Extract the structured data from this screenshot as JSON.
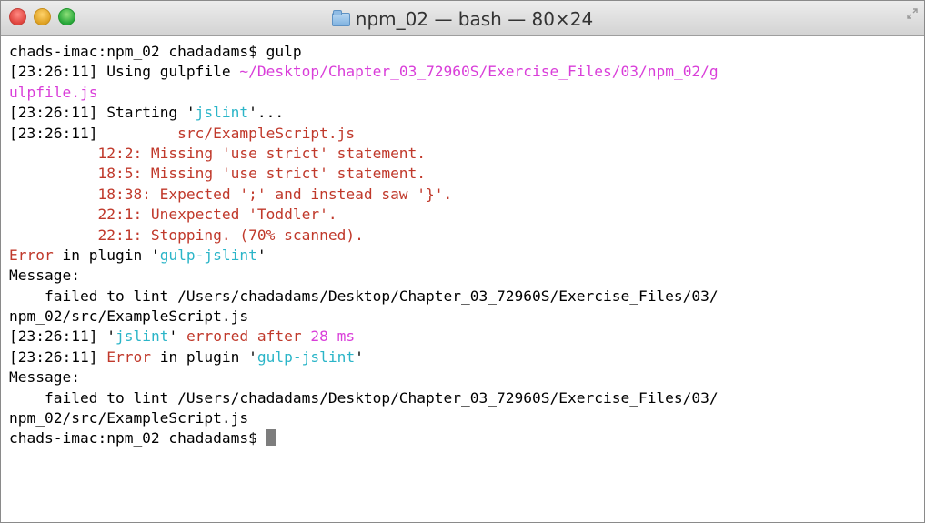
{
  "window": {
    "title": "npm_02 — bash — 80×24"
  },
  "terminal": {
    "colors": {
      "red": "#c0392b",
      "cyan": "#2bb5c8",
      "magenta": "#d93ed9",
      "default": "#000000"
    },
    "lines": [
      {
        "prompt": "chads-imac:npm_02 chadadams$ ",
        "cmd": "gulp"
      },
      {
        "ts": "[23:26:11]",
        "text": " Using gulpfile ",
        "path": "~/Desktop/Chapter_03_72960S/Exercise_Files/03/npm_02/g"
      },
      {
        "path_cont": "ulpfile.js"
      },
      {
        "ts": "[23:26:11]",
        "text": " Starting '",
        "task": "jslint",
        "text2": "'..."
      },
      {
        "ts": "[23:26:11]",
        "file": "         src/ExampleScript.js"
      },
      {
        "err": "          12:2: Missing 'use strict' statement."
      },
      {
        "err": "          18:5: Missing 'use strict' statement."
      },
      {
        "err": "          18:38: Expected ';' and instead saw '}'."
      },
      {
        "err": "          22:1: Unexpected 'Toddler'."
      },
      {
        "err": "          22:1: Stopping. (70% scanned)."
      },
      {
        "error_word": "Error",
        "text": " in plugin '",
        "plugin": "gulp-jslint",
        "text2": "'"
      },
      {
        "plain": "Message:"
      },
      {
        "plain": "    failed to lint /Users/chadadams/Desktop/Chapter_03_72960S/Exercise_Files/03/"
      },
      {
        "plain": "npm_02/src/ExampleScript.js"
      },
      {
        "ts": "[23:26:11]",
        "text": " '",
        "task": "jslint",
        "text2": "' ",
        "errored": "errored after",
        "space": " ",
        "time": "28 ms"
      },
      {
        "ts": "[23:26:11]",
        "text": " ",
        "error_word": "Error",
        "text2": " in plugin '",
        "plugin": "gulp-jslint",
        "text3": "'"
      },
      {
        "plain": "Message:"
      },
      {
        "plain": "    failed to lint /Users/chadadams/Desktop/Chapter_03_72960S/Exercise_Files/03/"
      },
      {
        "plain": "npm_02/src/ExampleScript.js"
      },
      {
        "prompt": "chads-imac:npm_02 chadadams$ "
      }
    ]
  }
}
